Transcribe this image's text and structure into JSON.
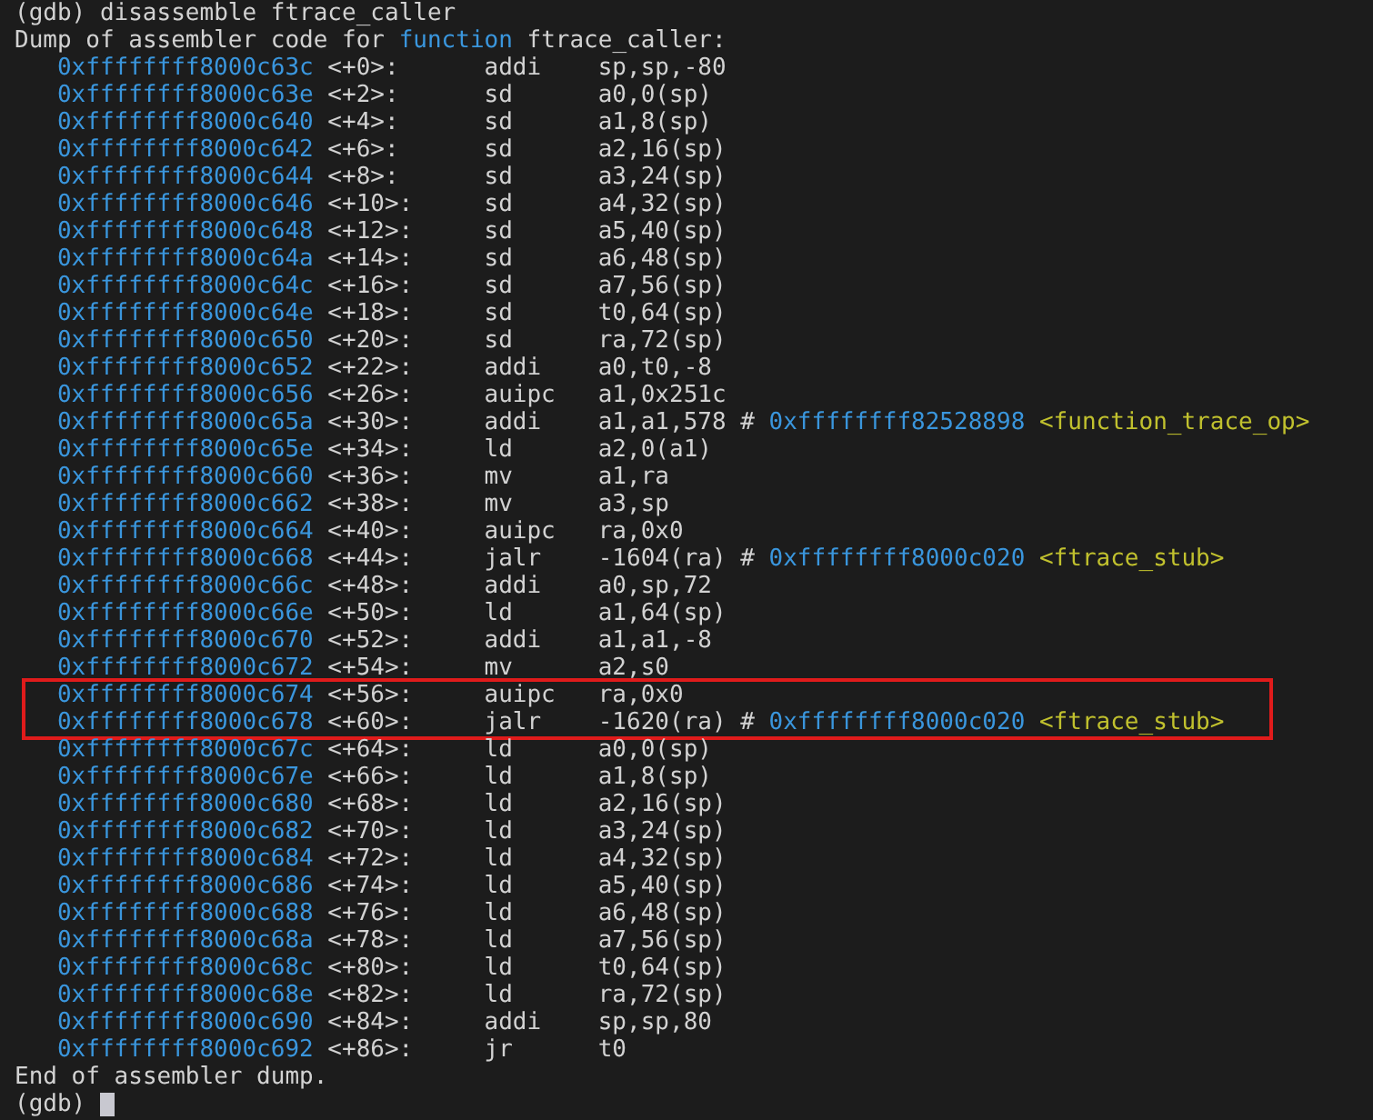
{
  "command_line": {
    "prompt": "(gdb)",
    "command": "disassemble ftrace_caller"
  },
  "header": {
    "text": "Dump of assembler code for",
    "keyword": "function",
    "name": "ftrace_caller:"
  },
  "rows": [
    {
      "address": "0xffffffff8000c63c",
      "offset": "<+0>:",
      "mnemonic": "addi",
      "operands": "sp,sp,-80",
      "highlighted": false
    },
    {
      "address": "0xffffffff8000c63e",
      "offset": "<+2>:",
      "mnemonic": "sd",
      "operands": "a0,0(sp)",
      "highlighted": false
    },
    {
      "address": "0xffffffff8000c640",
      "offset": "<+4>:",
      "mnemonic": "sd",
      "operands": "a1,8(sp)",
      "highlighted": false
    },
    {
      "address": "0xffffffff8000c642",
      "offset": "<+6>:",
      "mnemonic": "sd",
      "operands": "a2,16(sp)",
      "highlighted": false
    },
    {
      "address": "0xffffffff8000c644",
      "offset": "<+8>:",
      "mnemonic": "sd",
      "operands": "a3,24(sp)",
      "highlighted": false
    },
    {
      "address": "0xffffffff8000c646",
      "offset": "<+10>:",
      "mnemonic": "sd",
      "operands": "a4,32(sp)",
      "highlighted": false
    },
    {
      "address": "0xffffffff8000c648",
      "offset": "<+12>:",
      "mnemonic": "sd",
      "operands": "a5,40(sp)",
      "highlighted": false
    },
    {
      "address": "0xffffffff8000c64a",
      "offset": "<+14>:",
      "mnemonic": "sd",
      "operands": "a6,48(sp)",
      "highlighted": false
    },
    {
      "address": "0xffffffff8000c64c",
      "offset": "<+16>:",
      "mnemonic": "sd",
      "operands": "a7,56(sp)",
      "highlighted": false
    },
    {
      "address": "0xffffffff8000c64e",
      "offset": "<+18>:",
      "mnemonic": "sd",
      "operands": "t0,64(sp)",
      "highlighted": false
    },
    {
      "address": "0xffffffff8000c650",
      "offset": "<+20>:",
      "mnemonic": "sd",
      "operands": "ra,72(sp)",
      "highlighted": false
    },
    {
      "address": "0xffffffff8000c652",
      "offset": "<+22>:",
      "mnemonic": "addi",
      "operands": "a0,t0,-8",
      "highlighted": false
    },
    {
      "address": "0xffffffff8000c656",
      "offset": "<+26>:",
      "mnemonic": "auipc",
      "operands": "a1,0x251c",
      "highlighted": false
    },
    {
      "address": "0xffffffff8000c65a",
      "offset": "<+30>:",
      "mnemonic": "addi",
      "operands": "a1,a1,578",
      "comment_marker": "#",
      "comment_address": "0xffffffff82528898",
      "comment_symbol": "<function_trace_op>",
      "highlighted": false
    },
    {
      "address": "0xffffffff8000c65e",
      "offset": "<+34>:",
      "mnemonic": "ld",
      "operands": "a2,0(a1)",
      "highlighted": false
    },
    {
      "address": "0xffffffff8000c660",
      "offset": "<+36>:",
      "mnemonic": "mv",
      "operands": "a1,ra",
      "highlighted": false
    },
    {
      "address": "0xffffffff8000c662",
      "offset": "<+38>:",
      "mnemonic": "mv",
      "operands": "a3,sp",
      "highlighted": false
    },
    {
      "address": "0xffffffff8000c664",
      "offset": "<+40>:",
      "mnemonic": "auipc",
      "operands": "ra,0x0",
      "highlighted": false
    },
    {
      "address": "0xffffffff8000c668",
      "offset": "<+44>:",
      "mnemonic": "jalr",
      "operands": "-1604(ra)",
      "comment_marker": "#",
      "comment_address": "0xffffffff8000c020",
      "comment_symbol": "<ftrace_stub>",
      "highlighted": false
    },
    {
      "address": "0xffffffff8000c66c",
      "offset": "<+48>:",
      "mnemonic": "addi",
      "operands": "a0,sp,72",
      "highlighted": false
    },
    {
      "address": "0xffffffff8000c66e",
      "offset": "<+50>:",
      "mnemonic": "ld",
      "operands": "a1,64(sp)",
      "highlighted": false
    },
    {
      "address": "0xffffffff8000c670",
      "offset": "<+52>:",
      "mnemonic": "addi",
      "operands": "a1,a1,-8",
      "highlighted": false
    },
    {
      "address": "0xffffffff8000c672",
      "offset": "<+54>:",
      "mnemonic": "mv",
      "operands": "a2,s0",
      "highlighted": false
    },
    {
      "address": "0xffffffff8000c674",
      "offset": "<+56>:",
      "mnemonic": "auipc",
      "operands": "ra,0x0",
      "highlighted": true
    },
    {
      "address": "0xffffffff8000c678",
      "offset": "<+60>:",
      "mnemonic": "jalr",
      "operands": "-1620(ra)",
      "comment_marker": "#",
      "comment_address": "0xffffffff8000c020",
      "comment_symbol": "<ftrace_stub>",
      "highlighted": true
    },
    {
      "address": "0xffffffff8000c67c",
      "offset": "<+64>:",
      "mnemonic": "ld",
      "operands": "a0,0(sp)",
      "highlighted": false
    },
    {
      "address": "0xffffffff8000c67e",
      "offset": "<+66>:",
      "mnemonic": "ld",
      "operands": "a1,8(sp)",
      "highlighted": false
    },
    {
      "address": "0xffffffff8000c680",
      "offset": "<+68>:",
      "mnemonic": "ld",
      "operands": "a2,16(sp)",
      "highlighted": false
    },
    {
      "address": "0xffffffff8000c682",
      "offset": "<+70>:",
      "mnemonic": "ld",
      "operands": "a3,24(sp)",
      "highlighted": false
    },
    {
      "address": "0xffffffff8000c684",
      "offset": "<+72>:",
      "mnemonic": "ld",
      "operands": "a4,32(sp)",
      "highlighted": false
    },
    {
      "address": "0xffffffff8000c686",
      "offset": "<+74>:",
      "mnemonic": "ld",
      "operands": "a5,40(sp)",
      "highlighted": false
    },
    {
      "address": "0xffffffff8000c688",
      "offset": "<+76>:",
      "mnemonic": "ld",
      "operands": "a6,48(sp)",
      "highlighted": false
    },
    {
      "address": "0xffffffff8000c68a",
      "offset": "<+78>:",
      "mnemonic": "ld",
      "operands": "a7,56(sp)",
      "highlighted": false
    },
    {
      "address": "0xffffffff8000c68c",
      "offset": "<+80>:",
      "mnemonic": "ld",
      "operands": "t0,64(sp)",
      "highlighted": false
    },
    {
      "address": "0xffffffff8000c68e",
      "offset": "<+82>:",
      "mnemonic": "ld",
      "operands": "ra,72(sp)",
      "highlighted": false
    },
    {
      "address": "0xffffffff8000c690",
      "offset": "<+84>:",
      "mnemonic": "addi",
      "operands": "sp,sp,80",
      "highlighted": false
    },
    {
      "address": "0xffffffff8000c692",
      "offset": "<+86>:",
      "mnemonic": "jr",
      "operands": "t0",
      "highlighted": false
    }
  ],
  "footer": "End of assembler dump.",
  "final_prompt": "(gdb)"
}
